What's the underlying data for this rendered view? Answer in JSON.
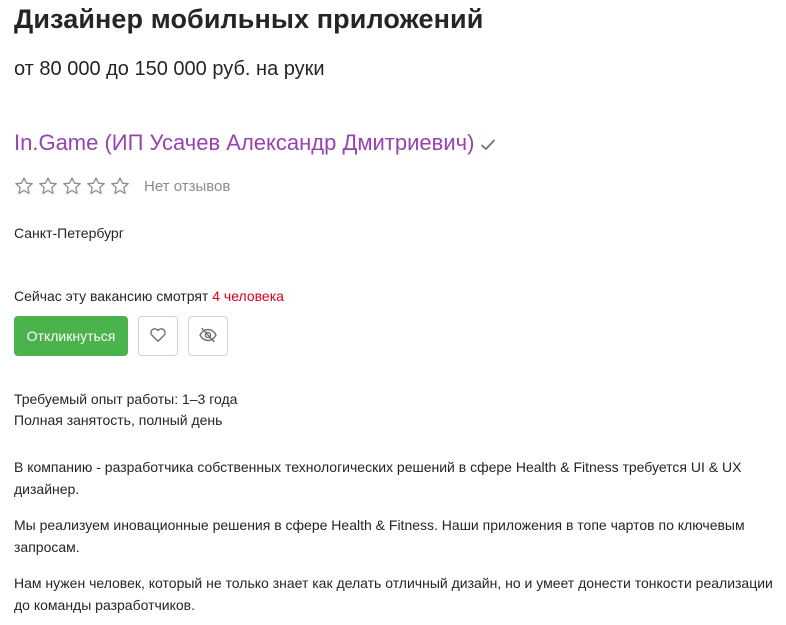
{
  "vacancy": {
    "title": "Дизайнер мобильных приложений",
    "salary": "от 80 000 до 150 000 руб. на руки"
  },
  "employer": {
    "name": "In.Game (ИП Усачев Александр Дмитриевич)",
    "verified_icon": "check-icon",
    "link_color": "#9743b0",
    "rating_stars_filled": 0,
    "rating_stars_total": 5,
    "reviews_label": "Нет отзывов"
  },
  "location": {
    "city": "Санкт-Петербург"
  },
  "watching": {
    "prefix": "Сейчас эту вакансию смотрят ",
    "count_text": "4 человека",
    "count_color": "#d6001c"
  },
  "actions": {
    "apply_label": "Откликнуться",
    "apply_color": "#4bb34b",
    "favorite_icon": "heart-icon",
    "hide_icon": "eye-off-icon"
  },
  "details": {
    "experience": "Требуемый опыт работы: 1–3 года",
    "employment": "Полная занятость, полный день"
  },
  "description": {
    "paragraphs": [
      "В компанию - разработчика собственных технологических решений в сфере Health & Fitness требуется UI & UX дизайнер.",
      "Мы реализуем иновационные решения в сфере Health & Fitness. Наши приложения в топе чартов по ключевым запросам.",
      "Нам нужен человек, который не только знает как делать отличный дизайн, но и умеет донести тонкости реализации до команды разработчиков."
    ]
  }
}
